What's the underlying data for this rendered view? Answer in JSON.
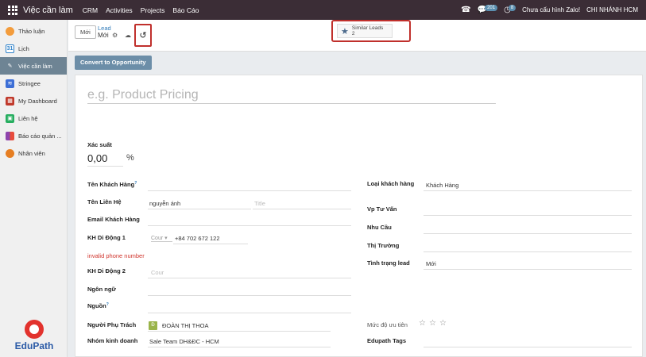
{
  "navbar": {
    "app_name": "Việc cần làm",
    "menus": [
      "CRM",
      "Activities",
      "Projects",
      "Báo Cáo"
    ],
    "messages_count": "201",
    "activities_count": "8",
    "zalo_status": "Chưa cấu hình Zalo!",
    "company": "CHI NHÁNH HCM"
  },
  "sidebar": {
    "items": [
      {
        "label": "Thảo luận",
        "icon": "discuss-icon",
        "color": "#f39c3c"
      },
      {
        "label": "Lịch",
        "icon": "calendar-icon",
        "color": "#2c80c9"
      },
      {
        "label": "Việc cần làm",
        "icon": "todo-icon",
        "color": "#6e8494"
      },
      {
        "label": "Stringee",
        "icon": "stringee-icon",
        "color": "#3d6fd6"
      },
      {
        "label": "My Dashboard",
        "icon": "dashboard-icon",
        "color": "#c0392b"
      },
      {
        "label": "Liên hệ",
        "icon": "contacts-icon",
        "color": "#27ae60"
      },
      {
        "label": "Báo cáo quản ...",
        "icon": "report-icon",
        "color": "#8e44ad"
      },
      {
        "label": "Nhân viên",
        "icon": "employees-icon",
        "color": "#e67e22"
      }
    ],
    "logo_text": "EduPath"
  },
  "control_panel": {
    "new_label": "Mới",
    "breadcrumb_parent": "Lead",
    "breadcrumb_current": "Mới",
    "similar_leads_label": "Similar Leads",
    "similar_leads_count": "2"
  },
  "statusbar": {
    "convert_label": "Convert to Opportunity"
  },
  "form": {
    "name_placeholder": "e.g. Product Pricing",
    "probability_label": "Xác suất",
    "probability_value": "0,00",
    "probability_unit": "%",
    "left": {
      "customer_name_label": "Tên Khách Hàng",
      "contact_name_label": "Tên Liên Hệ",
      "contact_name_value": "nguyễn ánh",
      "title_placeholder": "Title",
      "email_label": "Email Khách Hàng",
      "mobile1_label": "KH Di Động 1",
      "mobile1_country_placeholder": "Cour",
      "mobile1_value": "+84 702 672 122",
      "phone_error": "invalid phone number",
      "mobile2_label": "KH Di Động 2",
      "mobile2_placeholder": "Cour",
      "language_label": "Ngôn ngữ",
      "source_label": "Nguồn",
      "salesperson_label": "Người Phụ Trách",
      "salesperson_initial": "Đ",
      "salesperson_value": "ĐOÀN THỊ THOA",
      "sales_team_label": "Nhóm kinh doanh",
      "sales_team_value": "Sale Team DH&ĐC - HCM"
    },
    "right": {
      "customer_type_label": "Loại khách hàng",
      "customer_type_value": "Khách Hàng",
      "consultant_label": "Vp Tư Vấn",
      "need_label": "Nhu Cầu",
      "market_label": "Thị Trường",
      "lead_status_label": "Tình trạng lead",
      "lead_status_value": "Mới",
      "priority_label": "Mức độ ưu tiên",
      "priority_stars": 0,
      "tags_label": "Edupath Tags"
    }
  }
}
